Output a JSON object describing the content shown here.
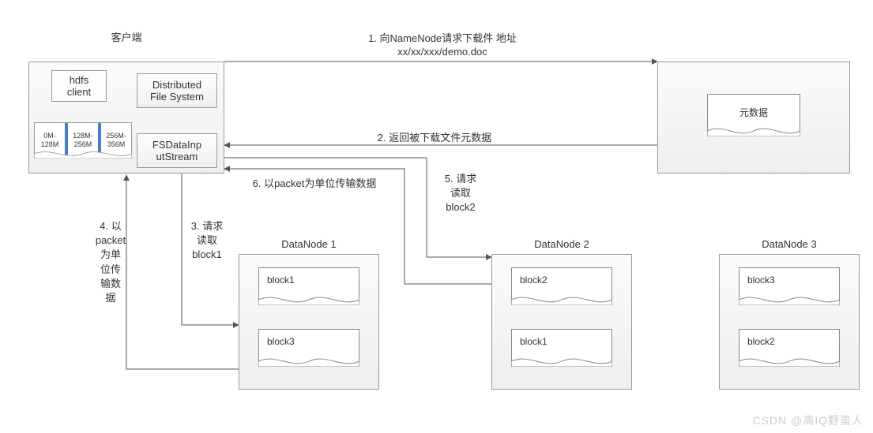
{
  "title_client": "客户端",
  "step1_label": "1. 向NameNode请求下载件 地址",
  "step1_path": "xx/xx/xxx/demo.doc",
  "step2_label": "2. 返回被下载文件元数据",
  "step3_label": "3. 请求\n读取\nblock1",
  "step4_label": "4. 以\npacket\n为单\n位传\n输数\n据",
  "step5_label": "5. 请求\n读取\nblock2",
  "step6_label": "6. 以packet为单位传输数据",
  "client": {
    "hdfs": "hdfs\nclient",
    "dfs": "Distributed\nFile System",
    "fsin": "FSDataInp\nutStream",
    "range1": "0M-\n128M",
    "range2": "128M-\n256M",
    "range3": "256M-\n356M"
  },
  "namenode": {
    "meta": "元数据"
  },
  "dn1": {
    "title": "DataNode 1",
    "b1": "block1",
    "b2": "block3"
  },
  "dn2": {
    "title": "DataNode 2",
    "b1": "block2",
    "b2": "block1"
  },
  "dn3": {
    "title": "DataNode 3",
    "b1": "block3",
    "b2": "block2"
  },
  "watermark": "CSDN @高IQ野蛮人"
}
